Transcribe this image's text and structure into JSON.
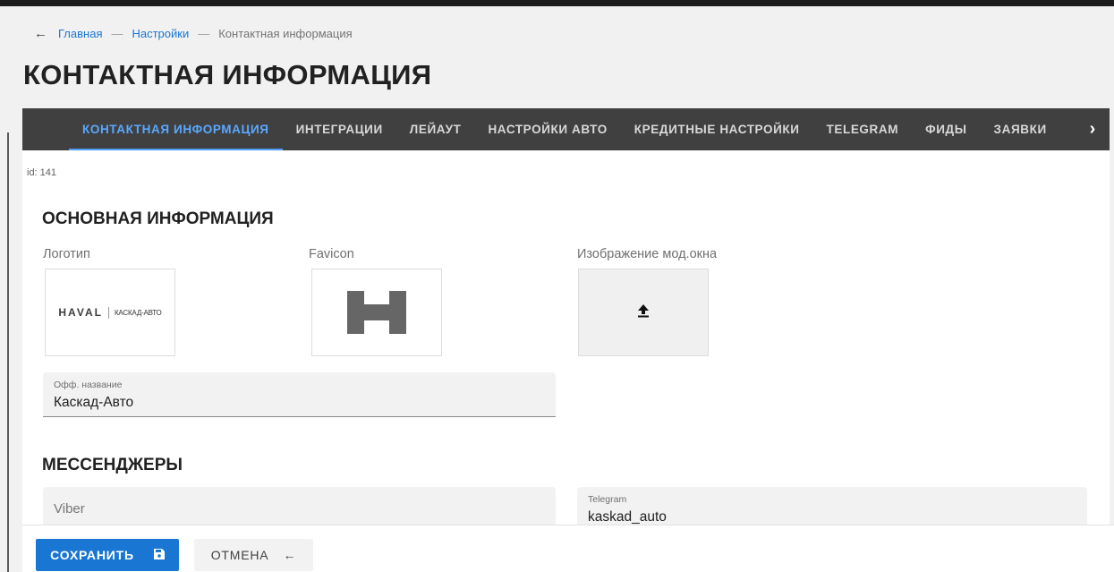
{
  "breadcrumb": {
    "back_icon": "arrow-left-icon",
    "items": [
      "Главная",
      "Настройки",
      "Контактная информация"
    ],
    "separator": "—"
  },
  "page_title": "КОНТАКТНАЯ ИНФОРМАЦИЯ",
  "tabs": {
    "items": [
      {
        "label": "КОНТАКТНАЯ ИНФОРМАЦИЯ",
        "active": true
      },
      {
        "label": "ИНТЕГРАЦИИ"
      },
      {
        "label": "ЛЕЙАУТ"
      },
      {
        "label": "НАСТРОЙКИ АВТО"
      },
      {
        "label": "КРЕДИТНЫЕ НАСТРОЙКИ"
      },
      {
        "label": "TELEGRAM"
      },
      {
        "label": "ФИДЫ"
      },
      {
        "label": "ЗАЯВКИ"
      }
    ],
    "next_icon": "chevron-right-icon"
  },
  "record_id": "id: 141",
  "main_info": {
    "title": "ОСНОВНАЯ ИНФОРМАЦИЯ",
    "logo_label": "Логотип",
    "logo_brand": "HAVAL",
    "logo_dealer": "КАСКАД-АВТО",
    "favicon_label": "Favicon",
    "modal_image_label": "Изображение мод.окна",
    "official_name": {
      "label": "Офф. название",
      "value": "Каскад-Авто"
    }
  },
  "messengers": {
    "title": "МЕССЕНДЖЕРЫ",
    "viber": {
      "label": "Viber",
      "value": ""
    },
    "telegram": {
      "label": "Telegram",
      "value": "kaskad_auto"
    }
  },
  "footer": {
    "save_label": "СОХРАНИТЬ",
    "save_icon": "floppy-disk-icon",
    "cancel_label": "ОТМЕНА",
    "cancel_icon": "arrow-left-icon"
  },
  "colors": {
    "primary": "#1976d2",
    "tab_active": "#5aa8ff",
    "tabbar_bg": "#404040"
  }
}
